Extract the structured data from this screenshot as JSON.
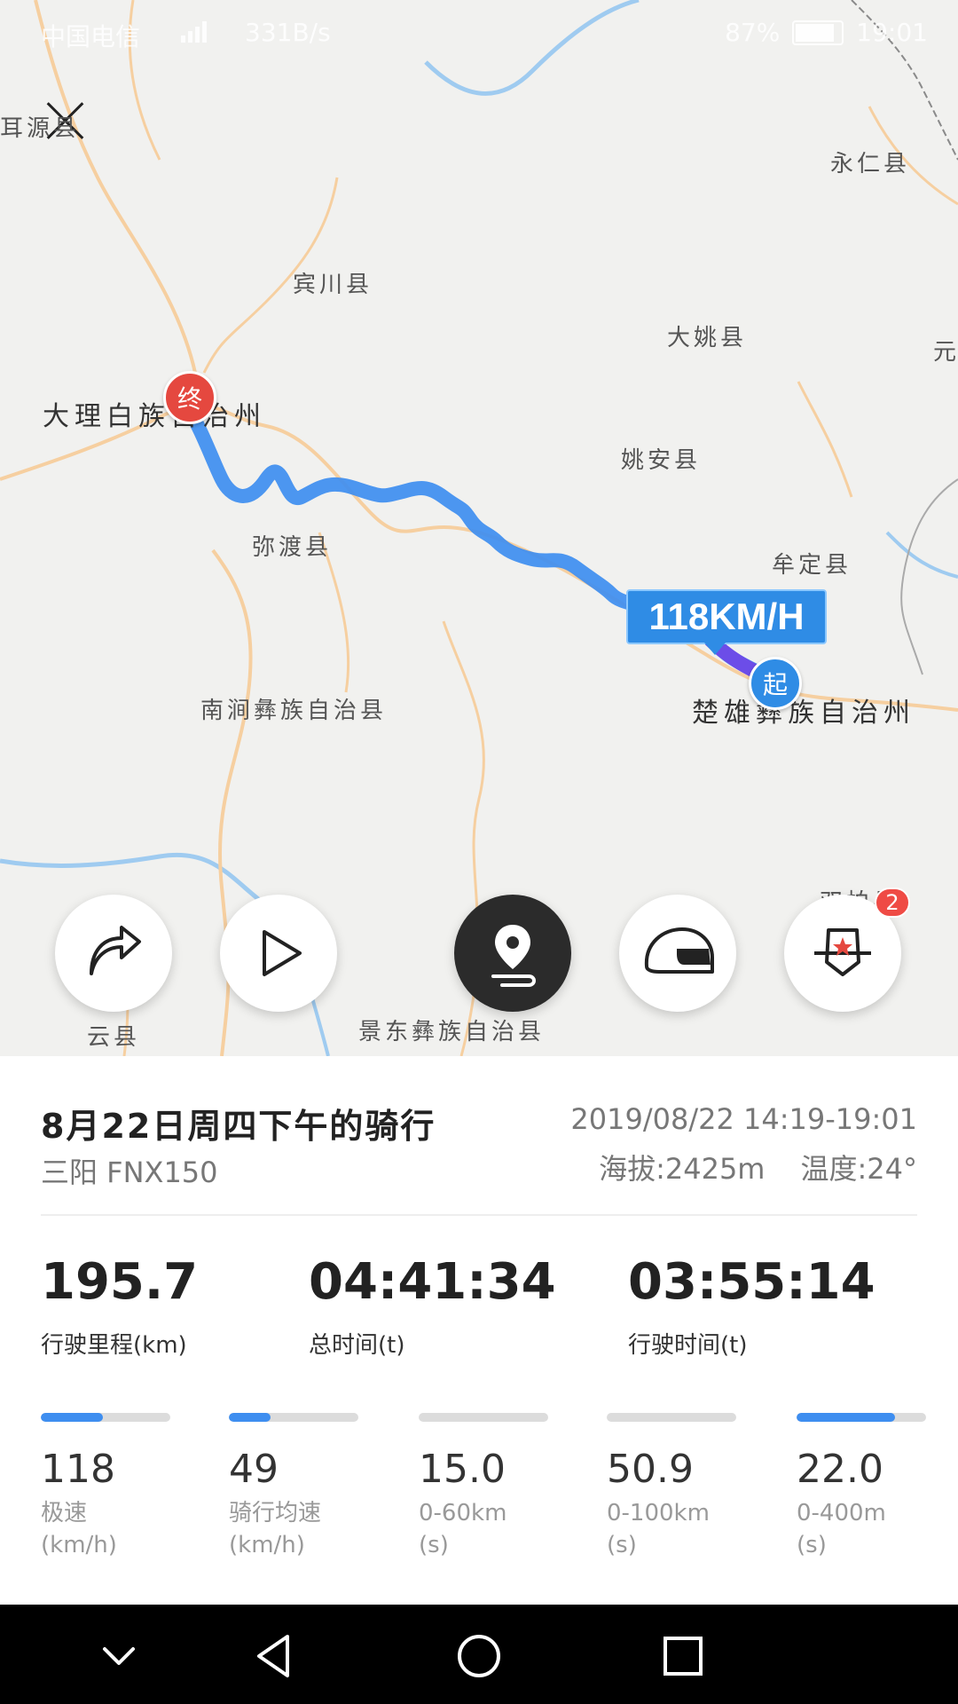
{
  "status_bar": {
    "carrier": "中国电信",
    "net_speed": "331B/s",
    "battery": "87%",
    "time": "19:01"
  },
  "map": {
    "labels": {
      "top_left": "耳源县",
      "binchuan": "宾川县",
      "yongren": "永仁县",
      "dayao": "大姚县",
      "yuan": "元",
      "dali": "大理白族自治州",
      "yaoan": "姚安县",
      "midu": "弥渡县",
      "mouding": "牟定县",
      "nanjian": "南涧彝族自治县",
      "chuxiong": "楚雄彝族自治州",
      "yunxian": "云县",
      "jingdong": "景东彝族自治县",
      "shuangbai": "双柏县"
    },
    "end_pin": "终",
    "start_pin": "起",
    "max_speed_tag": "118KM/H"
  },
  "actions": {
    "badge_count": "2"
  },
  "ride": {
    "title": "8月22日周四下午的骑行",
    "vehicle": "三阳 FNX150",
    "datetime": "2019/08/22 14:19-19:01",
    "altitude": "海拔:2425m",
    "temperature": "温度:24°"
  },
  "stats": {
    "distance": {
      "value": "195.7",
      "label": "行驶里程(km)"
    },
    "total_time": {
      "value": "04:41:34",
      "label": "总时间(t)"
    },
    "riding_time": {
      "value": "03:55:14",
      "label": "行驶时间(t)"
    }
  },
  "mini_stats": [
    {
      "value": "118",
      "label1": "极速",
      "label2": "(km/h)",
      "fill": 0.48
    },
    {
      "value": "49",
      "label1": "骑行均速",
      "label2": "(km/h)",
      "fill": 0.32
    },
    {
      "value": "15.0",
      "label1": "0-60km",
      "label2": "(s)",
      "fill": 0
    },
    {
      "value": "50.9",
      "label1": "0-100km",
      "label2": "(s)",
      "fill": 0
    },
    {
      "value": "22.0",
      "label1": "0-400m",
      "label2": "(s)",
      "fill": 0.76
    }
  ]
}
